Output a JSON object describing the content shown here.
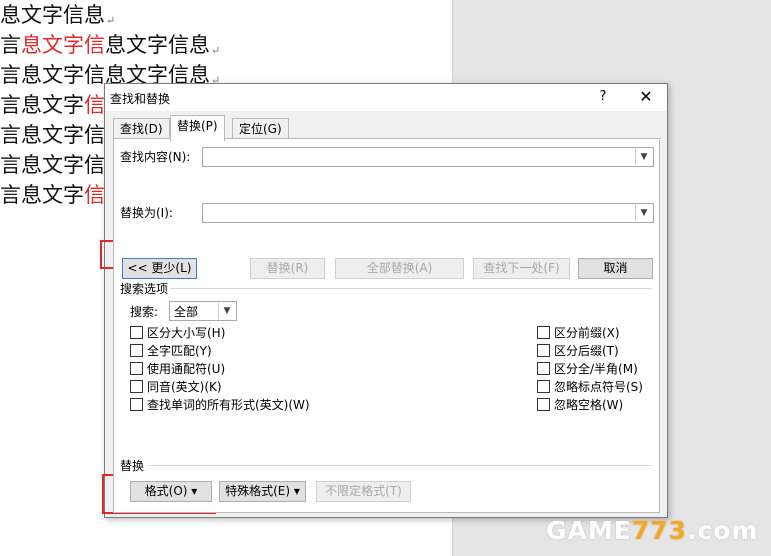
{
  "document": {
    "lines": [
      {
        "segments": [
          {
            "text": "息文字信息",
            "red": false
          }
        ]
      },
      {
        "segments": [
          {
            "text": "言",
            "red": false
          },
          {
            "text": "息文字信",
            "red": true
          },
          {
            "text": "息文字信息",
            "red": false
          }
        ]
      },
      {
        "segments": [
          {
            "text": "言息文字信息文字信息",
            "red": false
          }
        ]
      },
      {
        "segments": [
          {
            "text": "言息文字",
            "red": false
          },
          {
            "text": "信",
            "red": true
          }
        ]
      },
      {
        "segments": [
          {
            "text": "言息文字信",
            "red": false
          }
        ]
      },
      {
        "segments": [
          {
            "text": "言息文字信",
            "red": false
          }
        ]
      },
      {
        "segments": [
          {
            "text": "言息文字",
            "red": false
          },
          {
            "text": "信",
            "red": true
          }
        ]
      }
    ],
    "paragraph_mark": "↵"
  },
  "dialog": {
    "title": "查找和替换",
    "help_label": "?",
    "close_label": "✕",
    "tabs": [
      {
        "label": "查找(D)",
        "active": false
      },
      {
        "label": "替换(P)",
        "active": true
      },
      {
        "label": "定位(G)",
        "active": false
      }
    ],
    "find_label": "查找内容(N):",
    "find_value": "",
    "replace_label": "替换为(I):",
    "replace_value": "",
    "buttons": {
      "less": "<< 更少(L)",
      "replace": "替换(R)",
      "replace_all": "全部替换(A)",
      "find_next": "查找下一处(F)",
      "cancel": "取消"
    },
    "search_options_heading": "搜索选项",
    "search_label": "搜索:",
    "search_value": "全部",
    "options_left": [
      "区分大小写(H)",
      "全字匹配(Y)",
      "使用通配符(U)",
      "同音(英文)(K)",
      "查找单词的所有形式(英文)(W)"
    ],
    "options_right": [
      "区分前缀(X)",
      "区分后缀(T)",
      "区分全/半角(M)",
      "忽略标点符号(S)",
      "忽略空格(W)"
    ],
    "replace_section_heading": "替换",
    "format_button": "格式(O) ▾",
    "special_button": "特殊格式(E) ▾",
    "no_format_button": "不限定格式(T)"
  },
  "watermark": {
    "prefix": "GAME",
    "number": "773",
    "suffix": ".com"
  },
  "colors": {
    "highlight_red": "#e0282a",
    "focus_blue": "#3b7bd1"
  }
}
